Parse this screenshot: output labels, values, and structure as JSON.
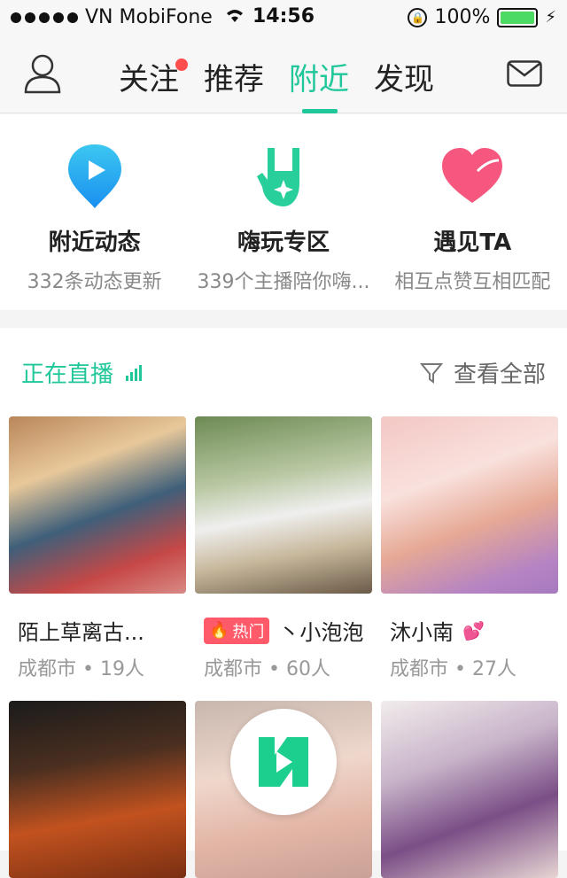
{
  "status_bar": {
    "carrier": "VN MobiFone",
    "time": "14:56",
    "battery": "100%"
  },
  "nav": {
    "tabs": [
      {
        "label": "关注",
        "badge": true
      },
      {
        "label": "推荐"
      },
      {
        "label": "附近",
        "active": true
      },
      {
        "label": "发现"
      }
    ]
  },
  "features": [
    {
      "title": "附近动态",
      "subtitle": "332条动态更新",
      "icon": "location-play-icon"
    },
    {
      "title": "嗨玩专区",
      "subtitle": "339个主播陪你嗨...",
      "icon": "rock-hand-icon"
    },
    {
      "title": "遇见TA",
      "subtitle": "相互点赞互相匹配",
      "icon": "heart-icon"
    }
  ],
  "live": {
    "title": "正在直播",
    "view_all": "查看全部"
  },
  "streams": [
    {
      "name": "陌上草离古...",
      "location": "成都市",
      "viewers": "19人",
      "hot": false
    },
    {
      "name": "丶小泡泡..",
      "location": "成都市",
      "viewers": "60人",
      "hot": true,
      "hot_label": "热门"
    },
    {
      "name": "沐小南",
      "location": "成都市",
      "viewers": "27人",
      "hot": false
    }
  ],
  "colors": {
    "accent": "#1fc79a",
    "badge_red": "#ff4e4e",
    "hot_pink": "#ff5a6a"
  }
}
